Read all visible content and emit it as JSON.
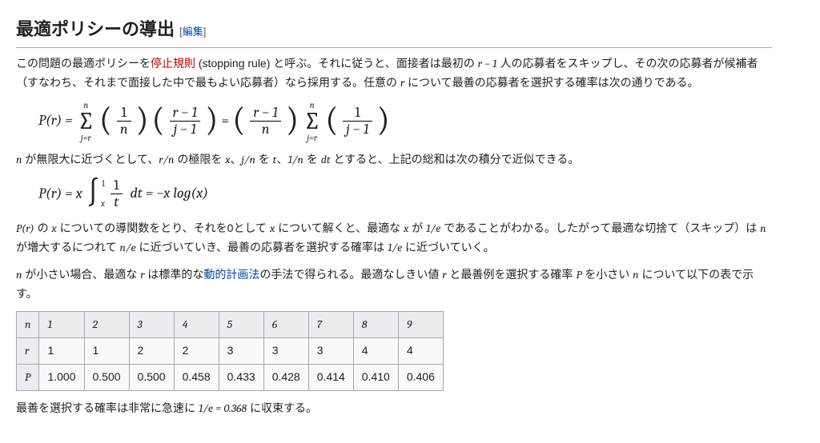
{
  "heading": {
    "title": "最適ポリシーの導出",
    "edit_open": "[",
    "edit_label": "編集",
    "edit_close": "]"
  },
  "paragraphs": {
    "p1a": "この問題の最適ポリシーを",
    "red_link": "停止規則",
    "p1b": " (stopping rule) と呼ぶ。それに従うと、面接者は最初の ",
    "p1c": " 人の応募者をスキップし、その次の応募者が候補者（すなわち、それまで面接した中で最もよい応募者）なら採用する。任意の ",
    "p1d": " について最善の応募者を選択する確率は次の通りである。",
    "p2a": " が無限大に近づくとして、",
    "p2b": " の極限を ",
    "p2c": "、",
    "p2d": " を ",
    "p2e": "、",
    "p2f": " を ",
    "p2g": " とすると、上記の総和は次の積分で近似できる。",
    "p3a": " の ",
    "p3b": " についての導関数をとり、それを0として ",
    "p3c": " について解くと、最適な ",
    "p3d": " が ",
    "p3e": " であることがわかる。したがって最適な切捨て（スキップ）は ",
    "p3f": " が増大するにつれて ",
    "p3g": " に近づいていき、最善の応募者を選択する確率は ",
    "p3h": " に近づいていく。",
    "p4a": " が小さい場合、最適な ",
    "p4b": " は標準的な",
    "link_dp": "動的計画法",
    "p4c": "の手法で得られる。最適なしきい値 ",
    "p4d": " と最善例を選択する確率 ",
    "p4e": " を小さい ",
    "p4f": " について以下の表で示す。",
    "p5a": "最善を選択する確率は非常に急速に ",
    "p5b": " に収束する。"
  },
  "math": {
    "r_minus_1": "r − 1",
    "r": "r",
    "n": "n",
    "x": "x",
    "t": "t",
    "P": "P",
    "Pr": "P(r)",
    "r_over_n": "r/n",
    "j_over_n": "j/n",
    "one_over_n": "1/n",
    "dt": "dt",
    "one_over_e": "1/e",
    "n_over_e": "n/e",
    "approx": "1/e ≈ 0.368",
    "eq1": {
      "lhs": "P(r) =",
      "sum_upper": "n",
      "sum_lower": "j=r",
      "f1_num": "1",
      "f1_den": "n",
      "f2_num": "r − 1",
      "f2_den": "j − 1",
      "f3_num": "r − 1",
      "f3_den": "n",
      "f4_num": "1",
      "f4_den": "j − 1"
    },
    "eq2": {
      "lhs": "P(r) = x",
      "int_u": "1",
      "int_l": "x",
      "frac_num": "1",
      "frac_den": "t",
      "rest": "dt = −x log(x)"
    }
  },
  "table": {
    "head_n": "n",
    "head_r": "r",
    "head_P": "P",
    "cols": [
      "1",
      "2",
      "3",
      "4",
      "5",
      "6",
      "7",
      "8",
      "9"
    ],
    "r_row": [
      "1",
      "1",
      "2",
      "2",
      "3",
      "3",
      "3",
      "4",
      "4"
    ],
    "p_row": [
      "1.000",
      "0.500",
      "0.500",
      "0.458",
      "0.433",
      "0.428",
      "0.414",
      "0.410",
      "0.406"
    ]
  }
}
